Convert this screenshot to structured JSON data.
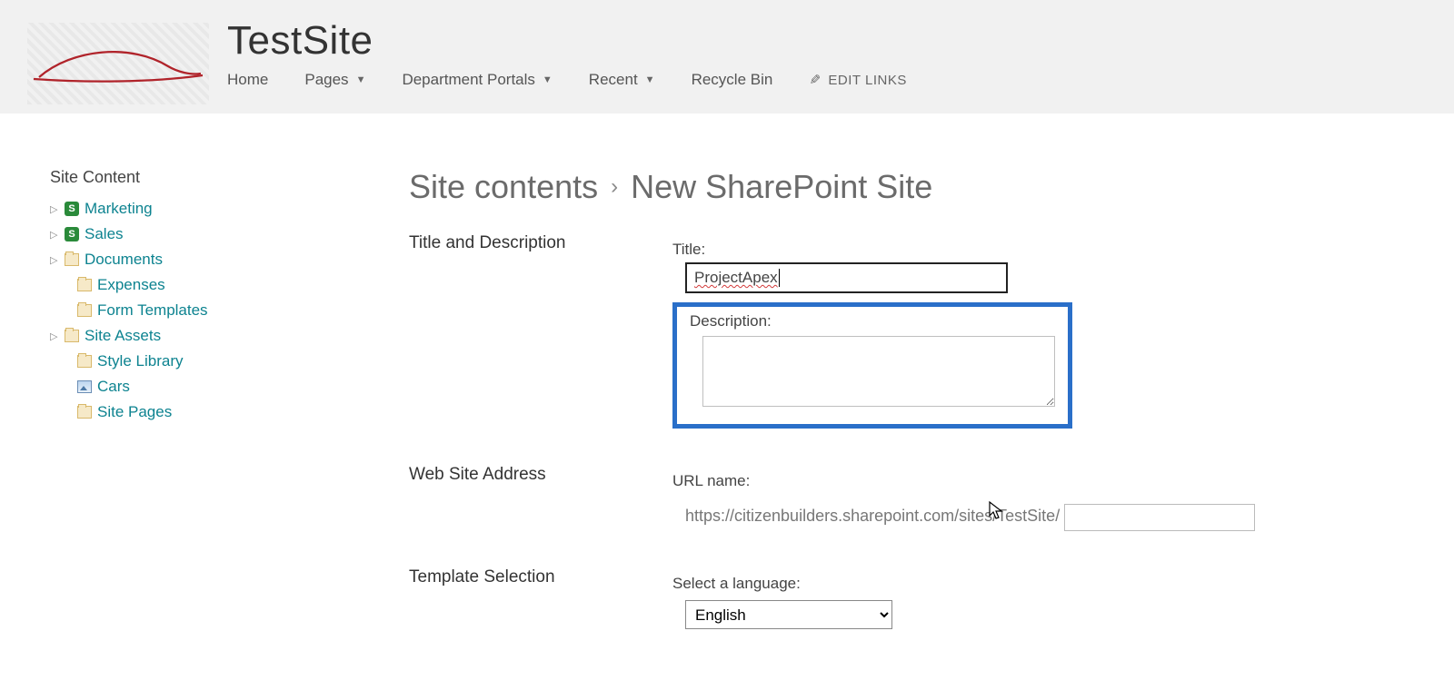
{
  "header": {
    "site_title": "TestSite",
    "nav": [
      {
        "label": "Home",
        "dropdown": false
      },
      {
        "label": "Pages",
        "dropdown": true
      },
      {
        "label": "Department Portals",
        "dropdown": true
      },
      {
        "label": "Recent",
        "dropdown": true
      },
      {
        "label": "Recycle Bin",
        "dropdown": false
      }
    ],
    "edit_links": "EDIT LINKS"
  },
  "sidebar": {
    "heading": "Site Content",
    "items": [
      {
        "label": "Marketing",
        "icon": "green-s",
        "expandable": true
      },
      {
        "label": "Sales",
        "icon": "green-s",
        "expandable": true
      },
      {
        "label": "Documents",
        "icon": "folder",
        "expandable": true
      },
      {
        "label": "Expenses",
        "icon": "folder",
        "expandable": false
      },
      {
        "label": "Form Templates",
        "icon": "folder",
        "expandable": false
      },
      {
        "label": "Site Assets",
        "icon": "folder",
        "expandable": true
      },
      {
        "label": "Style Library",
        "icon": "folder",
        "expandable": false
      },
      {
        "label": "Cars",
        "icon": "pic",
        "expandable": false
      },
      {
        "label": "Site Pages",
        "icon": "folder",
        "expandable": false
      }
    ]
  },
  "main": {
    "breadcrumb": {
      "part1": "Site contents",
      "part2": "New SharePoint Site"
    },
    "sections": {
      "title_desc": {
        "heading": "Title and Description",
        "title_label": "Title:",
        "title_value": "ProjectApex",
        "desc_label": "Description:",
        "desc_value": ""
      },
      "web_addr": {
        "heading": "Web Site Address",
        "url_label": "URL name:",
        "url_prefix": "https://citizenbuilders.sharepoint.com/sites/TestSite/",
        "url_value": ""
      },
      "template": {
        "heading": "Template Selection",
        "lang_label": "Select a language:",
        "lang_value": "English"
      }
    }
  }
}
